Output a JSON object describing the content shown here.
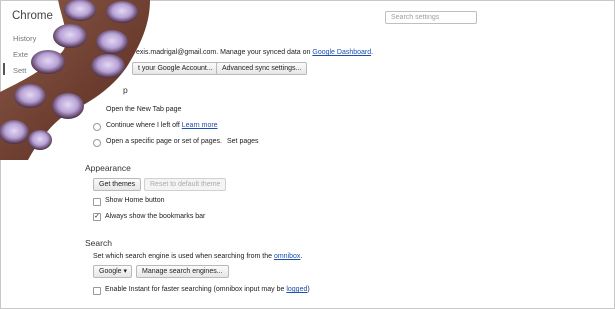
{
  "app_title": "Chrome",
  "sidebar": {
    "items": [
      "History",
      "Exte",
      "Sett"
    ]
  },
  "search": {
    "placeholder": "Search settings"
  },
  "sync": {
    "text": "exis.madrigal@gmail.com. Manage your synced data on",
    "dashboard_link": "Google Dashboard",
    "disconnect_button": "t your Google Account...",
    "advanced_button": "Advanced sync settings..."
  },
  "on_startup": {
    "heading_fragment": "p",
    "options": [
      "Open the New Tab page",
      "Continue where I left off",
      "Open a specific page or set of pages."
    ],
    "learn_more": "Learn more",
    "set_pages": "Set pages",
    "selected_index": 0
  },
  "appearance": {
    "heading": "Appearance",
    "get_themes": "Get themes",
    "reset_theme": "Reset to default theme",
    "show_home": "Show Home button",
    "show_home_checked": false,
    "bookmarks_bar": "Always show the bookmarks bar",
    "bookmarks_bar_checked": true
  },
  "search_section": {
    "heading": "Search",
    "description": "Set which search engine is used when searching from the",
    "omnibox_link": "omnibox",
    "engine": "Google",
    "manage_button": "Manage search engines...",
    "instant_label": "Enable Instant for faster searching (omnibox input may be",
    "logged_link": "logged",
    "instant_checked": false
  },
  "colors": {
    "link": "#1a4fb0",
    "octopus_body": "#6b3c2e",
    "octopus_sucker": "#b7a2d6"
  }
}
